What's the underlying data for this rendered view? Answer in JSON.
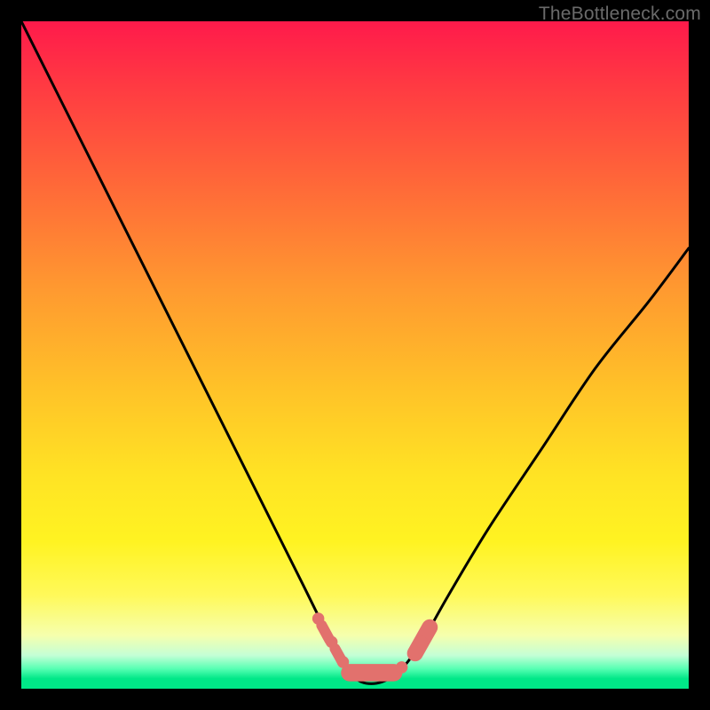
{
  "watermark": "TheBottleneck.com",
  "colors": {
    "frame": "#000000",
    "curve": "#000000",
    "marker": "#e2716d",
    "gradient_top": "#ff1a4b",
    "gradient_bottom": "#00e888"
  },
  "chart_data": {
    "type": "line",
    "title": "",
    "xlabel": "",
    "ylabel": "",
    "xlim": [
      0,
      100
    ],
    "ylim": [
      0,
      100
    ],
    "grid": false,
    "legend": false,
    "series": [
      {
        "name": "bottleneck-curve",
        "x": [
          0,
          6,
          12,
          18,
          24,
          30,
          36,
          42,
          46,
          49,
          51,
          54,
          57,
          60,
          64,
          70,
          78,
          86,
          94,
          100
        ],
        "values": [
          100,
          88,
          76,
          64,
          52,
          40,
          28,
          16,
          8,
          3,
          1,
          1,
          3,
          7,
          14,
          24,
          36,
          48,
          58,
          66
        ]
      }
    ],
    "markers": [
      {
        "x": 44.5,
        "y": 10.5,
        "r": 0.9
      },
      {
        "x": 46.5,
        "y": 7.0,
        "r": 0.9
      },
      {
        "x": 48.2,
        "y": 4.0,
        "r": 0.9
      },
      {
        "x": 57.0,
        "y": 3.2,
        "r": 0.9
      },
      {
        "x": 60.0,
        "y": 7.0,
        "r": 0.9
      }
    ],
    "capsules": [
      {
        "x1": 45.0,
        "y1": 9.5,
        "x2": 46.2,
        "y2": 7.3,
        "r": 0.8
      },
      {
        "x1": 47.0,
        "y1": 6.0,
        "x2": 48.0,
        "y2": 4.2,
        "r": 0.8
      },
      {
        "x1": 49.2,
        "y1": 2.4,
        "x2": 55.8,
        "y2": 2.4,
        "r": 1.3
      },
      {
        "x1": 59.0,
        "y1": 5.3,
        "x2": 61.2,
        "y2": 9.2,
        "r": 1.2
      }
    ],
    "annotations": []
  }
}
